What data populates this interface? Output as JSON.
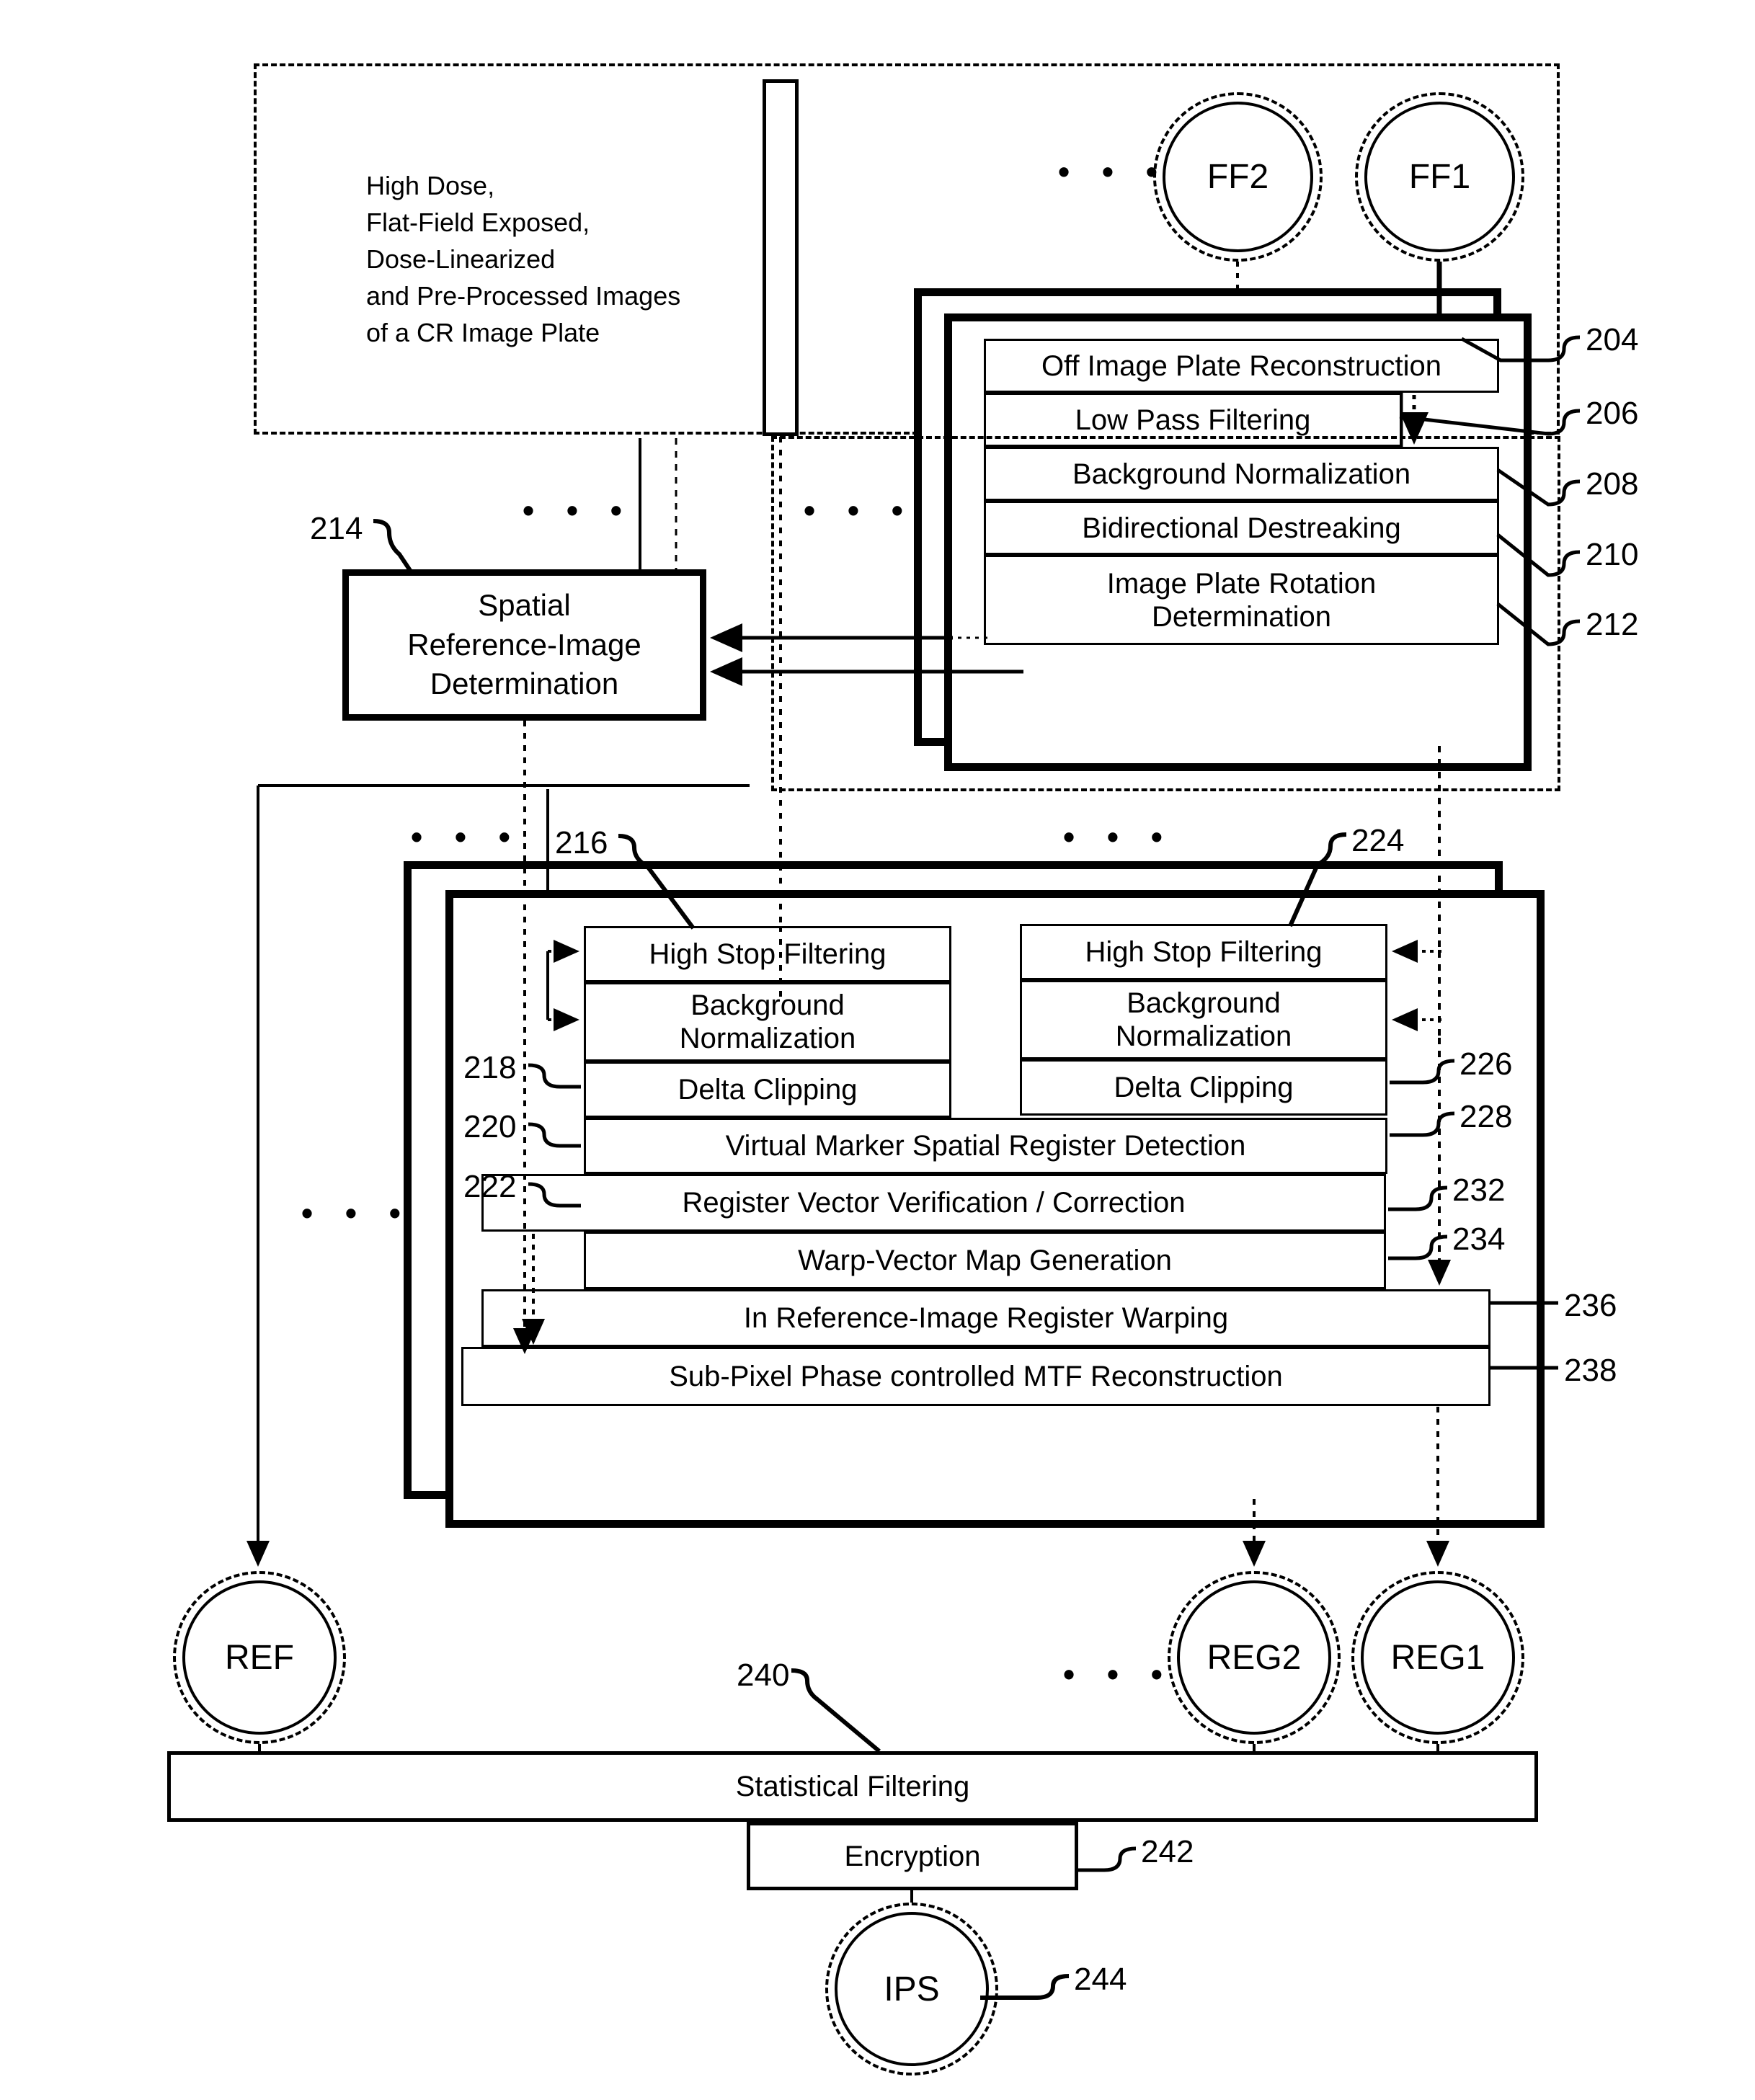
{
  "figure": {
    "note_block": "High Dose,\nFlat-Field Exposed,\nDose-Linearized\nand Pre-Processed Images\nof a CR Image Plate",
    "ellipsis": "• • •"
  },
  "nodes": {
    "ff2": "FF2",
    "ff1": "FF1",
    "ref": "REF",
    "reg2": "REG2",
    "reg1": "REG1",
    "ips": "IPS"
  },
  "flatfield_stack": {
    "rows": [
      {
        "label": "Off Image Plate Reconstruction",
        "ref": "204"
      },
      {
        "label": "Low Pass Filtering",
        "ref": "206"
      },
      {
        "label": "Background Normalization",
        "ref": "208"
      },
      {
        "label": "Bidirectional Destreaking",
        "ref": "210"
      },
      {
        "label": "Image Plate Rotation\nDetermination",
        "ref": "212"
      }
    ],
    "refs": [
      "204",
      "206",
      "208",
      "210",
      "212"
    ]
  },
  "spatial_box": {
    "label": "Spatial\nReference-Image\nDetermination",
    "ref": "214"
  },
  "register_stack": {
    "left_column": [
      {
        "label": "High Stop Filtering",
        "ref": "216"
      },
      {
        "label": "Background\nNormalization",
        "ref": "218"
      },
      {
        "label": "Delta Clipping",
        "ref": "220"
      }
    ],
    "right_column": [
      {
        "label": "High Stop Filtering",
        "ref": "224"
      },
      {
        "label": "Background\nNormalization",
        "ref": "226"
      },
      {
        "label": "Delta Clipping",
        "ref": "228"
      }
    ],
    "full_rows": [
      {
        "label": "Virtual Marker Spatial Register Detection",
        "ref": "222"
      },
      {
        "label": "Register Vector Verification / Correction",
        "ref": "232"
      },
      {
        "label": "Warp-Vector Map Generation",
        "ref": "234"
      },
      {
        "label": "In Reference-Image Register Warping",
        "ref": "236"
      },
      {
        "label": "Sub-Pixel Phase controlled MTF Reconstruction",
        "ref": "238"
      }
    ],
    "refs_left": [
      "216",
      "218",
      "220",
      "222"
    ],
    "refs_right": [
      "224",
      "226",
      "228",
      "232",
      "234",
      "236",
      "238"
    ]
  },
  "output_stage": {
    "statistical_filtering": {
      "label": "Statistical Filtering",
      "ref": "240"
    },
    "encryption": {
      "label": "Encryption",
      "ref": "242"
    },
    "ips_ref": "244"
  },
  "colors": {
    "ink": "#000000",
    "paper": "#ffffff"
  }
}
